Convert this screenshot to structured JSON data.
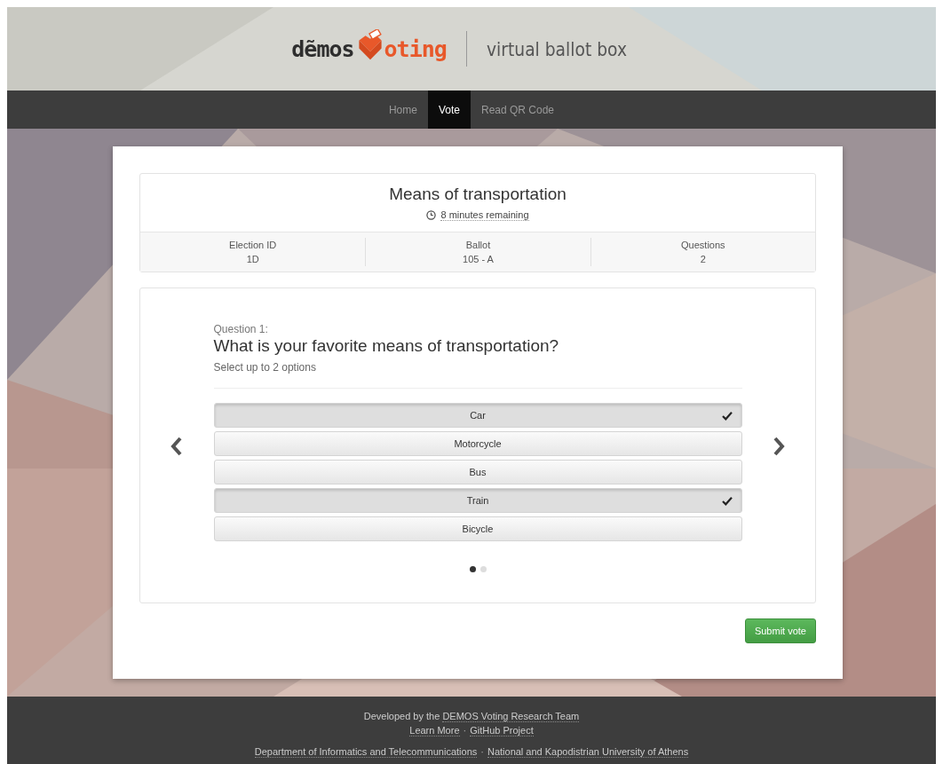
{
  "header": {
    "logo": {
      "left": "dẽmos",
      "right": "oting"
    },
    "tagline": "virtual ballot box"
  },
  "nav": [
    {
      "label": "Home",
      "selected": false
    },
    {
      "label": "Vote",
      "selected": true
    },
    {
      "label": "Read QR Code",
      "selected": false
    }
  ],
  "election": {
    "title": "Means of transportation",
    "timer": "8 minutes remaining",
    "details": [
      {
        "label": "Election ID",
        "value": "1D"
      },
      {
        "label": "Ballot",
        "value": "105 - A"
      },
      {
        "label": "Questions",
        "value": "2"
      }
    ]
  },
  "question": {
    "number": "Question 1:",
    "text": "What is your favorite means of transportation?",
    "hint": "Select up to 2 options",
    "options": [
      {
        "label": "Car",
        "selected": true
      },
      {
        "label": "Motorcycle",
        "selected": false
      },
      {
        "label": "Bus",
        "selected": false
      },
      {
        "label": "Train",
        "selected": true
      },
      {
        "label": "Bicycle",
        "selected": false
      }
    ],
    "pages": [
      {
        "selected": true
      },
      {
        "selected": false
      }
    ]
  },
  "submit": "Submit vote",
  "footer": {
    "credit": {
      "prefix": "Developed by the ",
      "link": "DEMOS Voting Research Team"
    },
    "link_lines": [
      {
        "items": [
          {
            "kind": "link",
            "text": "Learn More"
          },
          {
            "kind": "separator",
            "text": "·"
          },
          {
            "kind": "link",
            "text": "GitHub Project"
          }
        ]
      },
      {
        "items": [
          {
            "kind": "link",
            "text": "Department of Informatics and Telecommunications"
          },
          {
            "kind": "separator",
            "text": "·"
          },
          {
            "kind": "link",
            "text": "National and Kapodistrian University of Athens"
          }
        ]
      }
    ]
  }
}
